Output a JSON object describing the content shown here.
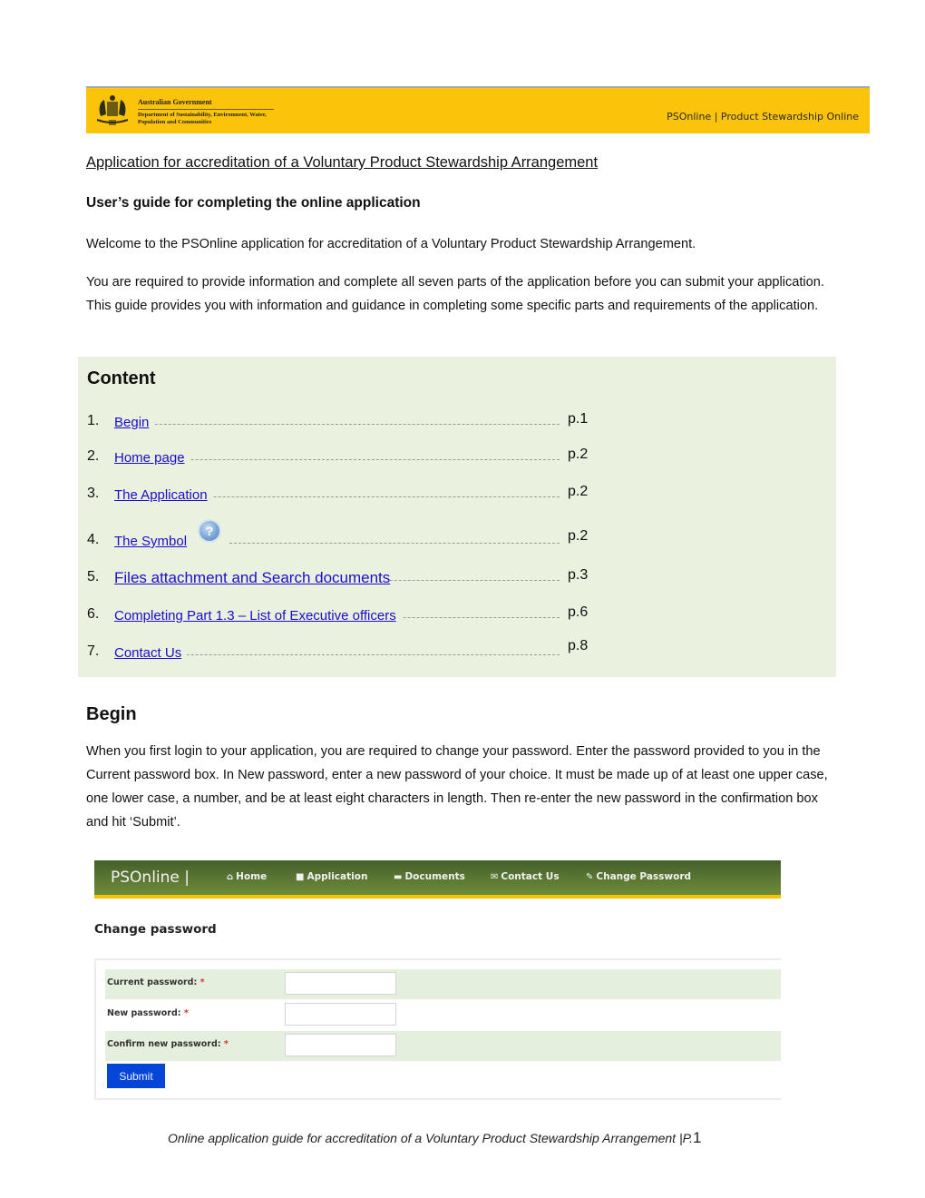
{
  "banner": {
    "gov_name": "Australian Government",
    "department": "Department of Sustainability, Environment, Water, Population and Communities",
    "site_title": "PSOnline | Product Stewardship Online",
    "background_color": "#fcc30b"
  },
  "document": {
    "title": "Application for accreditation of a Voluntary Product Stewardship Arrangement",
    "subtitle": "User’s guide for completing the online application",
    "intro_1": "Welcome to the PSOnline application for accreditation of a Voluntary Product Stewardship Arrangement.",
    "intro_2": "You are required to provide information and complete all seven parts of the application before you can submit your application. This guide provides you with information and guidance in completing some specific parts and requirements of the application."
  },
  "contents": {
    "heading": "Content",
    "items": [
      {
        "num": "1.",
        "label": "Begin",
        "page": "p.1"
      },
      {
        "num": "2.",
        "label": "Home page",
        "page": "p.2"
      },
      {
        "num": "3.",
        "label": "The Application",
        "page": "p.2"
      },
      {
        "num": "4.",
        "label": "The Symbol",
        "page": "p.2",
        "icon": "help-question-icon"
      },
      {
        "num": "5.",
        "label": "Files attachment and Search documents",
        "page": "p.3"
      },
      {
        "num": "6.",
        "label": "Completing Part 1.3 – List of Executive officers",
        "page": "p.6"
      },
      {
        "num": "7.",
        "label": "Contact Us",
        "page": "p.8"
      }
    ]
  },
  "begin": {
    "heading": "Begin",
    "text": "When you first login to your application, you are required to change your password. Enter the password provided to you in the Current password box. In New password, enter a new password of your choice. It must be made up of at least one upper case, one lower case, a number, and be at least eight characters in length. Then re-enter the new password in the confirmation box and hit ‘Submit’."
  },
  "screenshot": {
    "brand": "PSOnline |",
    "nav": [
      {
        "label": "Home",
        "icon": "home-icon",
        "glyph": "⌂"
      },
      {
        "label": "Application",
        "icon": "document-icon",
        "glyph": "■"
      },
      {
        "label": "Documents",
        "icon": "folder-icon",
        "glyph": "▬"
      },
      {
        "label": "Contact Us",
        "icon": "envelope-icon",
        "glyph": "✉"
      },
      {
        "label": "Change Password",
        "icon": "edit-icon",
        "glyph": "✎"
      }
    ],
    "form_title": "Change password",
    "fields": [
      {
        "label": "Current password:",
        "required": "*",
        "value": ""
      },
      {
        "label": "New password:",
        "required": "*",
        "value": ""
      },
      {
        "label": "Confirm new password:",
        "required": "*",
        "value": ""
      }
    ],
    "submit_label": "Submit"
  },
  "footer": {
    "text": "Online application guide for accreditation of a Voluntary Product Stewardship Arrangement |P.",
    "page_number": "1"
  }
}
